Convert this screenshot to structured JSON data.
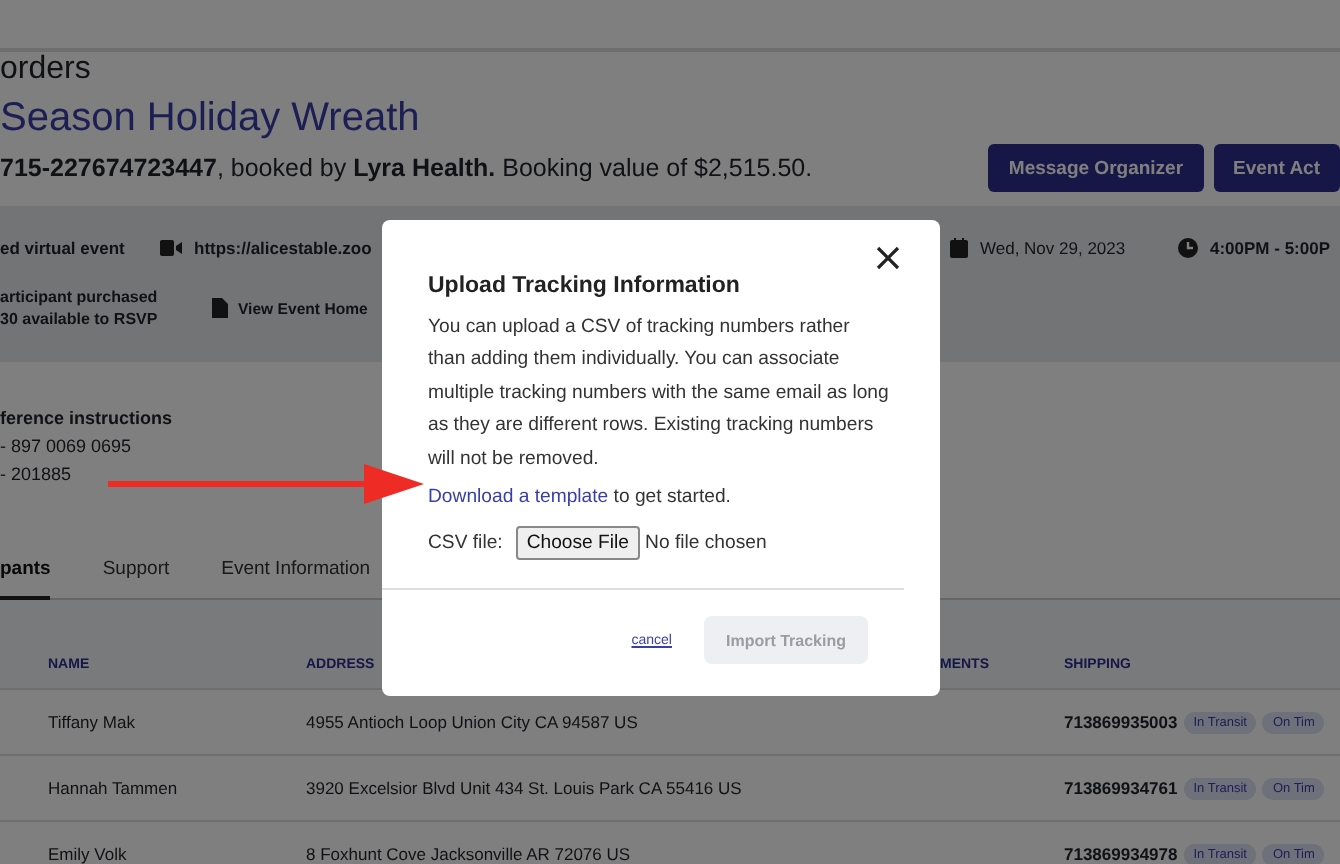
{
  "header": {
    "breadcrumb": "orders",
    "title": "Season Holiday Wreath",
    "booking": "**715-227674723447**, booked by **Lyra Health.** Booking value of $2,515.50.",
    "buttons": [
      {
        "label": "Message Organizer"
      },
      {
        "label": "Event Act"
      }
    ]
  },
  "event_info": {
    "event_type": "ed virtual event",
    "meeting_link": "https://alicestable.zoo",
    "participants": "articipant purchased",
    "rsvp": "30 available to RSVP",
    "home_link": "View Event Home",
    "date": "Wed, Nov 29, 2023",
    "time": "4:00PM - 5:00P"
  },
  "conference": {
    "heading": "ference instructions",
    "lines": [
      "- 897 0069 0695",
      "- 201885"
    ]
  },
  "tabs": [
    {
      "label": "pants",
      "selected": true
    },
    {
      "label": "Support",
      "selected": false
    },
    {
      "label": "Event Information",
      "selected": false
    }
  ],
  "table": {
    "columns": [
      "NAME",
      "ADDRESS",
      "MENTS",
      "SHIPPING"
    ],
    "rows": [
      {
        "name": "Tiffany Mak",
        "address": "4955 Antioch Loop Union City CA 94587 US",
        "tracking": "713869935003",
        "badges": [
          "In Transit",
          "On Tim"
        ]
      },
      {
        "name": "Hannah Tammen",
        "address": "3920 Excelsior Blvd Unit 434 St. Louis Park CA 55416 US",
        "tracking": "713869934761",
        "badges": [
          "In Transit",
          "On Tim"
        ]
      },
      {
        "name": "Emily Volk",
        "address": "8 Foxhunt Cove Jacksonville AR 72076 US",
        "tracking": "713869934978",
        "badges": [
          "In Transit",
          "On Tim"
        ]
      }
    ]
  },
  "dialog": {
    "title": "Upload Tracking Information",
    "body": "You can upload a CSV of tracking numbers rather than adding them individually. You can associate multiple tracking numbers with the same email as long as they are different rows. Existing tracking numbers will not be removed.",
    "link": "Download a template",
    "link_suffix": "to get started.",
    "csv_label": "CSV file:",
    "file_button": "Choose File",
    "file_status": "No file chosen",
    "cancel": "cancel",
    "import": {
      "label": "Import Tracking",
      "disabled": true
    }
  }
}
